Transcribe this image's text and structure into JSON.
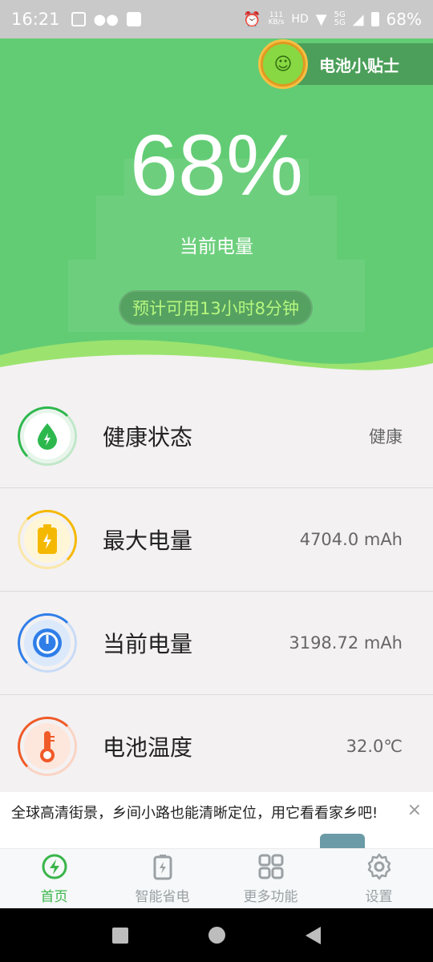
{
  "status_bar": {
    "time": "16:21",
    "battery_text": "68%",
    "network_speed_top": "111",
    "network_speed_bottom": "KB/s"
  },
  "hero": {
    "tips_label": "电池小贴士",
    "percent": "68%",
    "current_label": "当前电量",
    "estimate": "预计可用13小时8分钟",
    "colors": {
      "bg": "#62cc74",
      "estimate_text": "#b6f77f"
    }
  },
  "rows": [
    {
      "name": "健康状态",
      "value": "健康",
      "icon": "droplet-bolt-icon",
      "color": "#2db84d"
    },
    {
      "name": "最大电量",
      "value": "4704.0 mAh",
      "icon": "battery-bolt-icon",
      "color": "#f5b800"
    },
    {
      "name": "当前电量",
      "value": "3198.72 mAh",
      "icon": "gauge-icon",
      "color": "#2f7ee8"
    },
    {
      "name": "电池温度",
      "value": "32.0℃",
      "icon": "thermometer-icon",
      "color": "#f05a28"
    }
  ],
  "ad": {
    "text": "全球高清街景，乡间小路也能清晰定位，用它看看家乡吧!",
    "close": "×"
  },
  "nav": {
    "items": [
      {
        "label": "首页",
        "icon": "bolt-circle-icon",
        "active": true
      },
      {
        "label": "智能省电",
        "icon": "battery-icon",
        "active": false
      },
      {
        "label": "更多功能",
        "icon": "grid-icon",
        "active": false
      },
      {
        "label": "设置",
        "icon": "gear-icon",
        "active": false
      }
    ]
  }
}
